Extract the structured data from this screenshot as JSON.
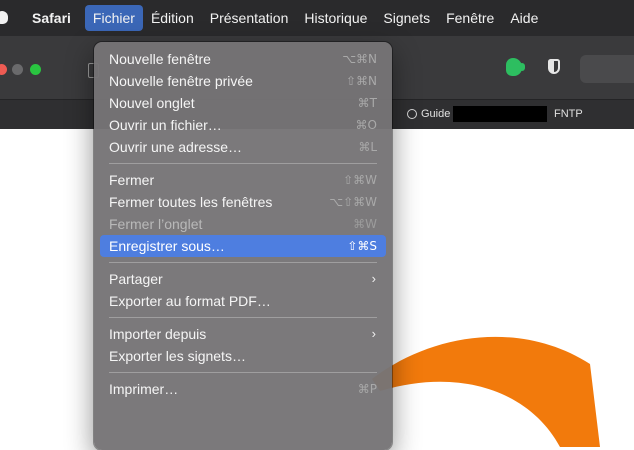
{
  "menubar": {
    "app_name": "Safari",
    "items": [
      "Fichier",
      "Édition",
      "Présentation",
      "Historique",
      "Signets",
      "Fenêtre",
      "Aide"
    ]
  },
  "bookmarks": {
    "items": [
      "Guide",
      "FNTP"
    ]
  },
  "menu": {
    "groups": [
      [
        {
          "label": "Nouvelle fenêtre",
          "shortcut": "⌥⌘N"
        },
        {
          "label": "Nouvelle fenêtre privée",
          "shortcut": "⇧⌘N"
        },
        {
          "label": "Nouvel onglet",
          "shortcut": "⌘T"
        },
        {
          "label": "Ouvrir un fichier…",
          "shortcut": "⌘O"
        },
        {
          "label": "Ouvrir une adresse…",
          "shortcut": "⌘L"
        }
      ],
      [
        {
          "label": "Fermer",
          "shortcut": "⇧⌘W"
        },
        {
          "label": "Fermer toutes les fenêtres",
          "shortcut": "⌥⇧⌘W"
        },
        {
          "label": "Fermer l’onglet",
          "shortcut": "⌘W"
        },
        {
          "label": "Enregistrer sous…",
          "shortcut": "⇧⌘S"
        }
      ],
      [
        {
          "label": "Partager",
          "submenu_arrow": "›"
        },
        {
          "label": "Exporter au format PDF…"
        }
      ],
      [
        {
          "label": "Importer depuis",
          "submenu_arrow": "›"
        },
        {
          "label": "Exporter les signets…"
        }
      ],
      [
        {
          "label": "Imprimer…",
          "shortcut": "⌘P"
        }
      ]
    ]
  },
  "colors": {
    "highlight": "#4e7ee0",
    "accent_orange": "#f27a0c",
    "evernote_green": "#2dbe60"
  },
  "icons": {
    "apple": "apple-icon",
    "evernote": "evernote-icon",
    "shield": "shield-icon",
    "sidebar": "sidebar-icon",
    "submenu": "chevron-right-icon"
  }
}
